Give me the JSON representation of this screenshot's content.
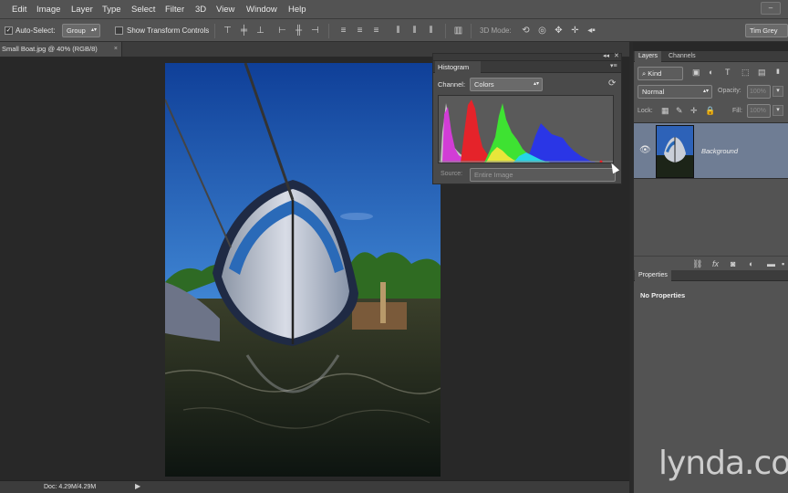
{
  "menubar": {
    "items": [
      "Edit",
      "Image",
      "Layer",
      "Type",
      "Select",
      "Filter",
      "3D",
      "View",
      "Window",
      "Help"
    ],
    "window_controls": [
      "–"
    ]
  },
  "options": {
    "auto_select_label": "Auto-Select:",
    "auto_select_value": "Group",
    "transform_label": "Show Transform Controls",
    "mode_3d_label": "3D Mode:",
    "workspace": "Tim Grey"
  },
  "document": {
    "tab_title": "Small Boat.jpg @ 40% (RGB/8)",
    "tab_close": "×",
    "status": "Doc: 4.29M/4.29M"
  },
  "histogram": {
    "tab": "Histogram",
    "channel_label": "Channel:",
    "channel_value": "Colors",
    "source_label": "Source:",
    "source_value": "Entire Image"
  },
  "layers": {
    "tabs": [
      "Layers",
      "Channels"
    ],
    "kind_value": "Kind",
    "blend_mode": "Normal",
    "opacity_label": "Opacity:",
    "opacity_value": "100%",
    "lock_label": "Lock:",
    "fill_label": "Fill:",
    "fill_value": "100%",
    "layer_name": "Background"
  },
  "properties": {
    "tab": "Properties",
    "message": "No Properties"
  },
  "watermark": "lynda.co",
  "colors": {
    "panel": "#535353",
    "selected_layer": "#6f7d94"
  }
}
